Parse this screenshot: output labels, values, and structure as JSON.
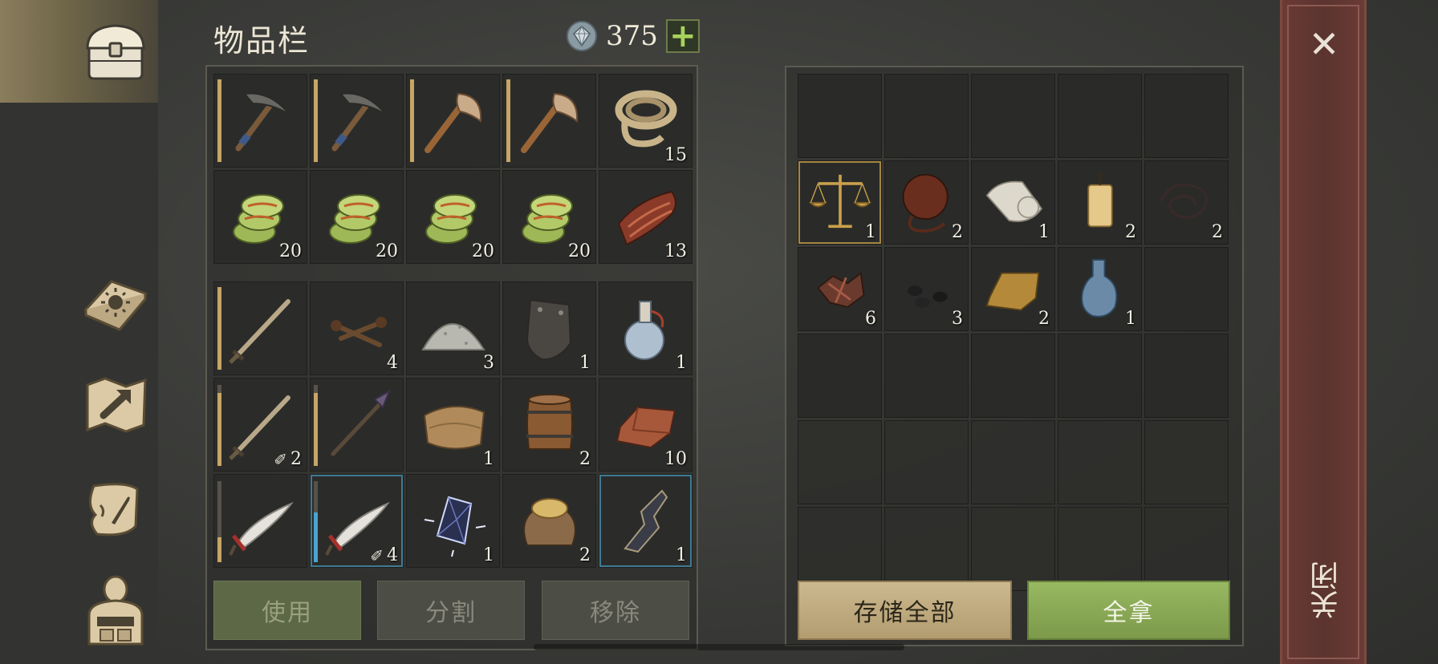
{
  "header": {
    "title": "物品栏",
    "currency_amount": "375",
    "add_label": "+"
  },
  "tabs": [
    {
      "name": "inventory",
      "icon": "chest-icon",
      "active": true
    },
    {
      "name": "journal",
      "icon": "sun-book-icon",
      "active": false
    },
    {
      "name": "map",
      "icon": "map-icon",
      "active": false
    },
    {
      "name": "quests",
      "icon": "scroll-icon",
      "active": false
    },
    {
      "name": "character",
      "icon": "backpack-icon",
      "active": false
    }
  ],
  "inventory": {
    "rows": [
      [
        {
          "item": "pickaxe-icon",
          "count": "",
          "durability": 1.0
        },
        {
          "item": "pickaxe-icon",
          "count": "",
          "durability": 1.0
        },
        {
          "item": "axe-icon",
          "count": "",
          "durability": 1.0
        },
        {
          "item": "axe-icon",
          "count": "",
          "durability": 1.0
        },
        {
          "item": "rope-icon",
          "count": "15"
        }
      ],
      [
        {
          "item": "plant-fiber-icon",
          "count": "20"
        },
        {
          "item": "plant-fiber-icon",
          "count": "20"
        },
        {
          "item": "plant-fiber-icon",
          "count": "20"
        },
        {
          "item": "plant-fiber-icon",
          "count": "20"
        },
        {
          "item": "raw-meat-icon",
          "count": "13"
        }
      ],
      [
        {
          "item": "sword-icon",
          "count": "",
          "durability": 1.0
        },
        {
          "item": "nails-icon",
          "count": "4"
        },
        {
          "item": "salt-pile-icon",
          "count": "3"
        },
        {
          "item": "metal-plate-icon",
          "count": "1"
        },
        {
          "item": "potion-flask-icon",
          "count": "1"
        }
      ],
      [
        {
          "item": "sword-icon",
          "count": "2",
          "durability": 0.88,
          "count_icon": "✐"
        },
        {
          "item": "spear-icon",
          "count": "",
          "durability": 0.88
        },
        {
          "item": "leather-icon",
          "count": "1"
        },
        {
          "item": "barrel-icon",
          "count": "2"
        },
        {
          "item": "copper-ingot-icon",
          "count": "10"
        }
      ],
      [
        {
          "item": "saber-icon",
          "count": "",
          "durability": 0.3
        },
        {
          "item": "saber-icon",
          "count": "4",
          "durability": 0.6,
          "count_icon": "✐",
          "highlight": "blue",
          "bar": "blue"
        },
        {
          "item": "crystal-icon",
          "count": "1"
        },
        {
          "item": "grain-sack-icon",
          "count": "2"
        },
        {
          "item": "weapon-part-icon",
          "count": "1",
          "highlight": "blue"
        }
      ]
    ],
    "buttons": {
      "use": "使用",
      "split": "分割",
      "remove": "移除"
    }
  },
  "storage": {
    "rows": [
      [
        {
          "item": ""
        },
        {
          "item": ""
        },
        {
          "item": ""
        },
        {
          "item": ""
        },
        {
          "item": ""
        }
      ],
      [
        {
          "item": "scales-icon",
          "count": "1",
          "highlight": "gold"
        },
        {
          "item": "waterskin-icon",
          "count": "2"
        },
        {
          "item": "cloth-roll-icon",
          "count": "1"
        },
        {
          "item": "candle-icon",
          "count": "2"
        },
        {
          "item": "wire-icon",
          "count": "2"
        }
      ],
      [
        {
          "item": "scrap-icon",
          "count": "6"
        },
        {
          "item": "coal-icon",
          "count": "3"
        },
        {
          "item": "gold-ingot-icon",
          "count": "2"
        },
        {
          "item": "bottle-icon",
          "count": "1"
        },
        {
          "item": ""
        }
      ],
      [
        {
          "item": ""
        },
        {
          "item": ""
        },
        {
          "item": ""
        },
        {
          "item": ""
        },
        {
          "item": ""
        }
      ],
      [
        {
          "item": ""
        },
        {
          "item": ""
        },
        {
          "item": ""
        },
        {
          "item": ""
        },
        {
          "item": ""
        }
      ],
      [
        {
          "item": ""
        },
        {
          "item": ""
        },
        {
          "item": ""
        },
        {
          "item": ""
        },
        {
          "item": ""
        }
      ]
    ],
    "buttons": {
      "store_all": "存储全部",
      "take_all": "全拿"
    }
  },
  "close": {
    "label": "关闭",
    "icon": "close-icon"
  }
}
